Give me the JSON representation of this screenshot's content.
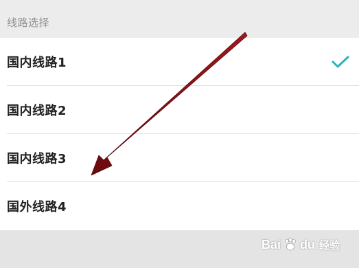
{
  "section": {
    "title": "线路选择"
  },
  "routes": [
    {
      "label": "国内线路1",
      "selected": true
    },
    {
      "label": "国内线路2",
      "selected": false
    },
    {
      "label": "国内线路3",
      "selected": false
    },
    {
      "label": "国外线路4",
      "selected": false
    }
  ],
  "watermark": {
    "brand_part1": "Bai",
    "brand_part2": "du",
    "sub": "经验"
  },
  "colors": {
    "check": "#2bb3b8",
    "arrow": "#7a0f12",
    "divider": "#e2e2e2"
  },
  "icons": {
    "check": "checkmark-icon",
    "annotation": "red-arrow-annotation",
    "watermark_logo": "baidu-paw-icon"
  }
}
